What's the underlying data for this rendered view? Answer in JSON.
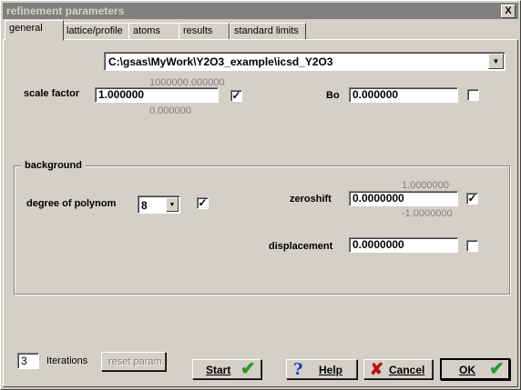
{
  "window": {
    "title": "refinement parameters",
    "close_glyph": "X"
  },
  "tabs": [
    {
      "label": "general",
      "active": true
    },
    {
      "label": "lattice/profile",
      "active": false
    },
    {
      "label": "atoms",
      "active": false
    },
    {
      "label": "results",
      "active": false
    },
    {
      "label": "standard limits",
      "active": false
    }
  ],
  "file_combo": {
    "value": "C:\\gsas\\MyWork\\Y2O3_example\\icsd_Y2O3",
    "icon": "down-arrow"
  },
  "scale": {
    "label": "scale factor",
    "value": "1.000000",
    "max": "1000000.000000",
    "min": "0.000000",
    "checked": true
  },
  "bo": {
    "label": "Bo",
    "value": "0.000000",
    "checked": false
  },
  "background": {
    "group_label": "background",
    "polynom_label": "degree of polynom",
    "polynom_value": "8",
    "polynom_checked": true
  },
  "zeroshift": {
    "label": "zeroshift",
    "value": "0.0000000",
    "max": "1.0000000",
    "min": "-1.0000000",
    "checked": true
  },
  "displacement": {
    "label": "displacement",
    "value": "0.0000000",
    "checked": false
  },
  "iterations": {
    "value": "3",
    "label": "Iterations"
  },
  "buttons": {
    "reset": "reset param.",
    "start": "Start",
    "help": "Help",
    "cancel": "Cancel",
    "ok": "OK"
  },
  "colors": {
    "check_icon": "#2a9a2a",
    "help_icon": "#1f3da8",
    "cancel_icon": "#c01010",
    "title_bar": "#808080"
  }
}
